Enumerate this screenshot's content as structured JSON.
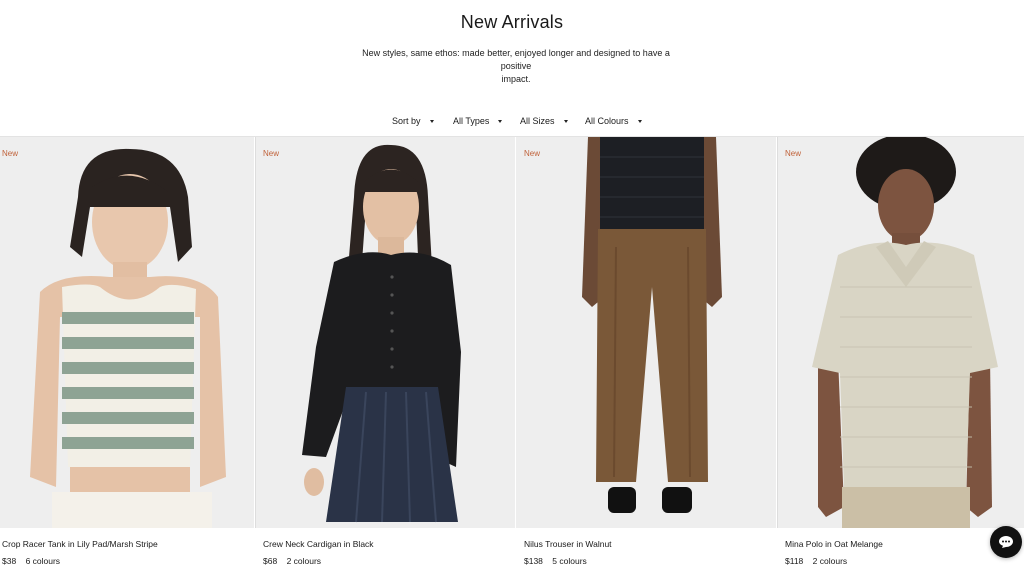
{
  "page": {
    "title": "New Arrivals",
    "subtitle_line1": "New styles, same ethos: made better, enjoyed longer and designed to have a positive",
    "subtitle_line2": "impact."
  },
  "filters": {
    "sort": "Sort by",
    "types": "All Types",
    "sizes": "All Sizes",
    "colours": "All Colours"
  },
  "products": [
    {
      "badge": "New",
      "name": "Crop Racer Tank in Lily Pad/Marsh Stripe",
      "price": "$38",
      "colours": "6 colours"
    },
    {
      "badge": "New",
      "name": "Crew Neck Cardigan in Black",
      "price": "$68",
      "colours": "2 colours"
    },
    {
      "badge": "New",
      "name": "Nilus Trouser in Walnut",
      "price": "$138",
      "colours": "5 colours"
    },
    {
      "badge": "New",
      "name": "Mina Polo in Oat Melange",
      "price": "$118",
      "colours": "2 colours"
    }
  ],
  "chat": {
    "icon": "chat-bubble-icon"
  },
  "colors": {
    "accent_badge": "#c0623a",
    "text": "#1a1a1a",
    "photo_bg": "#eeeeee"
  }
}
